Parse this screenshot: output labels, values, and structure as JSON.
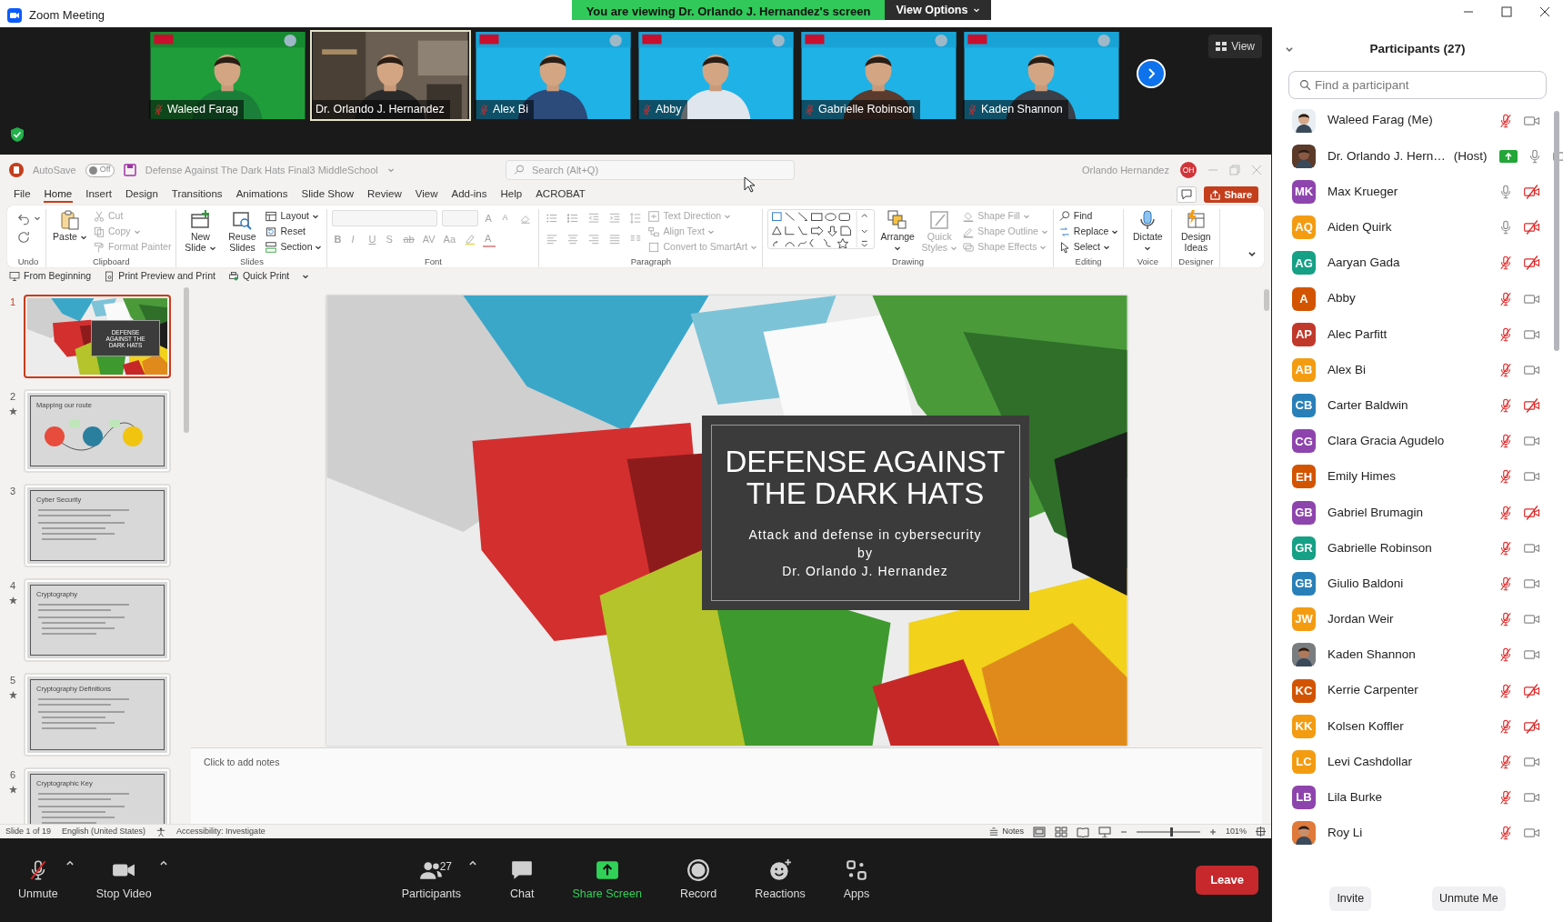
{
  "window": {
    "title": "Zoom Meeting"
  },
  "share_banner": {
    "text": "You are viewing Dr. Orlando J. Hernandez's screen",
    "button": "View Options"
  },
  "video_strip": {
    "view_button": "View",
    "tiles": [
      {
        "name": "Waleed Farag",
        "muted": true,
        "speaking": false,
        "kind": "green"
      },
      {
        "name": "Dr. Orlando J. Hernandez",
        "muted": false,
        "speaking": true,
        "kind": "office"
      },
      {
        "name": "Alex Bi",
        "muted": true,
        "speaking": false,
        "kind": "blue"
      },
      {
        "name": "Abby",
        "muted": true,
        "speaking": false,
        "kind": "blue"
      },
      {
        "name": "Gabrielle Robinson",
        "muted": true,
        "speaking": false,
        "kind": "blue"
      },
      {
        "name": "Kaden Shannon",
        "muted": true,
        "speaking": false,
        "kind": "blue"
      }
    ]
  },
  "powerpoint": {
    "autosave": {
      "label": "AutoSave",
      "toggle": "Off",
      "on": false
    },
    "file_title": "Defense Against The Dark Hats Final3 MiddleSchool",
    "search": {
      "placeholder": "Search (Alt+Q)"
    },
    "user": {
      "name": "Orlando Hernandez",
      "initials": "OH"
    },
    "share_button": "Share",
    "tabs": [
      {
        "label": "File",
        "selected": false
      },
      {
        "label": "Home",
        "selected": true
      },
      {
        "label": "Insert",
        "selected": false
      },
      {
        "label": "Design",
        "selected": false
      },
      {
        "label": "Transitions",
        "selected": false
      },
      {
        "label": "Animations",
        "selected": false
      },
      {
        "label": "Slide Show",
        "selected": false
      },
      {
        "label": "Review",
        "selected": false
      },
      {
        "label": "View",
        "selected": false
      },
      {
        "label": "Add-ins",
        "selected": false
      },
      {
        "label": "Help",
        "selected": false
      },
      {
        "label": "ACROBAT",
        "selected": false
      }
    ],
    "ribbon": [
      {
        "label": "Undo",
        "items": [
          {
            "kind": "icon",
            "disabled": false,
            "dropdown": true
          },
          {
            "kind": "icon",
            "disabled": false,
            "dropdown": false
          }
        ]
      },
      {
        "label": "Clipboard",
        "items": [
          {
            "kind": "large",
            "label": "Paste",
            "disabled": false,
            "dropdown": true
          },
          {
            "kind": "small",
            "label": "Cut",
            "disabled": true,
            "dropdown": false
          },
          {
            "kind": "small",
            "label": "Copy",
            "disabled": true,
            "dropdown": true
          },
          {
            "kind": "small",
            "label": "Format Painter",
            "disabled": true,
            "dropdown": false
          }
        ]
      },
      {
        "label": "Slides",
        "items": [
          {
            "kind": "large",
            "label": "New Slide",
            "disabled": false,
            "dropdown": true
          },
          {
            "kind": "large",
            "label": "Reuse Slides",
            "disabled": false,
            "dropdown": false
          },
          {
            "kind": "small",
            "label": "Layout",
            "disabled": false,
            "dropdown": true
          },
          {
            "kind": "small",
            "label": "Reset",
            "disabled": false,
            "dropdown": false
          },
          {
            "kind": "small",
            "label": "Section",
            "disabled": false,
            "dropdown": true
          }
        ]
      },
      {
        "label": "Font",
        "items": [
          {
            "kind": "toolrow",
            "tools": [
              {
                "kind": "field",
                "disabled": true
              },
              {
                "kind": "field",
                "disabled": true
              },
              {
                "kind": "text",
                "label": "A",
                "disabled": true
              },
              {
                "kind": "text",
                "label": "A",
                "disabled": true
              },
              {
                "kind": "icon",
                "disabled": true
              }
            ]
          },
          {
            "kind": "toolrow",
            "tools": [
              {
                "kind": "text",
                "label": "B",
                "disabled": true
              },
              {
                "kind": "text",
                "label": "I",
                "disabled": true
              },
              {
                "kind": "text",
                "label": "U",
                "disabled": true
              },
              {
                "kind": "text",
                "label": "S",
                "disabled": true
              },
              {
                "kind": "text",
                "label": "ab",
                "disabled": true
              },
              {
                "kind": "text",
                "label": "AV",
                "disabled": true
              },
              {
                "kind": "text",
                "label": "Aa",
                "disabled": true
              },
              {
                "kind": "icon",
                "disabled": true
              },
              {
                "kind": "text",
                "label": "A",
                "disabled": true
              }
            ]
          }
        ]
      },
      {
        "label": "Paragraph",
        "items": [
          {
            "kind": "toolrow",
            "tools": [
              {
                "kind": "icon",
                "disabled": true
              },
              {
                "kind": "icon",
                "disabled": true
              },
              {
                "kind": "icon",
                "disabled": true
              },
              {
                "kind": "icon",
                "disabled": true
              },
              {
                "kind": "icon",
                "disabled": true
              }
            ]
          },
          {
            "kind": "toolrow",
            "tools": [
              {
                "kind": "icon",
                "disabled": true
              },
              {
                "kind": "icon",
                "disabled": true
              },
              {
                "kind": "icon",
                "disabled": true
              },
              {
                "kind": "icon",
                "disabled": true
              },
              {
                "kind": "icon",
                "disabled": true
              }
            ]
          },
          {
            "kind": "small",
            "label": "Text Direction",
            "disabled": true,
            "dropdown": true
          },
          {
            "kind": "small",
            "label": "Align Text",
            "disabled": true,
            "dropdown": true
          },
          {
            "kind": "small",
            "label": "Convert to SmartArt",
            "disabled": true,
            "dropdown": true
          }
        ]
      },
      {
        "label": "Drawing",
        "items": [
          {
            "kind": "gallery"
          },
          {
            "kind": "large",
            "label": "Arrange",
            "disabled": false,
            "dropdown": true
          },
          {
            "kind": "large",
            "label": "Quick Styles",
            "disabled": true,
            "dropdown": true
          },
          {
            "kind": "small",
            "label": "Shape Fill",
            "disabled": true,
            "dropdown": true
          },
          {
            "kind": "small",
            "label": "Shape Outline",
            "disabled": true,
            "dropdown": true
          },
          {
            "kind": "small",
            "label": "Shape Effects",
            "disabled": true,
            "dropdown": true
          }
        ]
      },
      {
        "label": "Editing",
        "items": [
          {
            "kind": "small",
            "label": "Find",
            "disabled": false,
            "dropdown": false
          },
          {
            "kind": "small",
            "label": "Replace",
            "disabled": false,
            "dropdown": true
          },
          {
            "kind": "small",
            "label": "Select",
            "disabled": false,
            "dropdown": true
          }
        ]
      },
      {
        "label": "Voice",
        "items": [
          {
            "kind": "large",
            "label": "Dictate",
            "disabled": false,
            "dropdown": true
          }
        ]
      },
      {
        "label": "Designer",
        "items": [
          {
            "kind": "large",
            "label": "Design Ideas",
            "disabled": false,
            "dropdown": false
          }
        ]
      }
    ],
    "quick_access": [
      "From Beginning",
      "Print Preview and Print",
      "Quick Print"
    ],
    "slides": [
      {
        "number": "1",
        "title": "DEFENSE AGAINST THE DARK HATS",
        "kind": "cover",
        "animated": false,
        "selected": true
      },
      {
        "number": "2",
        "title": "Mapping our route",
        "kind": "diagram",
        "animated": true,
        "selected": false
      },
      {
        "number": "3",
        "title": "Cyber Security",
        "kind": "bullets",
        "animated": false,
        "selected": false
      },
      {
        "number": "4",
        "title": "Cryptography",
        "kind": "bullets",
        "animated": true,
        "selected": false
      },
      {
        "number": "5",
        "title": "Cryptography Definitions",
        "kind": "bullets",
        "animated": true,
        "selected": false
      },
      {
        "number": "6",
        "title": "Cryptographic Key",
        "kind": "bullets",
        "animated": true,
        "selected": false
      }
    ],
    "main_slide": {
      "title": "DEFENSE AGAINST THE DARK HATS",
      "lines": [
        "Attack and defense in cybersecurity",
        "by",
        "Dr. Orlando J. Hernandez"
      ]
    },
    "notes": {
      "placeholder": "Click to add notes"
    },
    "status": {
      "slide": "Slide 1 of 19",
      "language": "English (United States)",
      "accessibility": "Accessibility: Investigate",
      "notes": "Notes",
      "zoom": {
        "level": 0.55,
        "label": "101%"
      }
    }
  },
  "toolbar": {
    "items": [
      {
        "label": "Unmute",
        "caret": true,
        "accent": false
      },
      {
        "label": "Stop Video",
        "caret": true,
        "accent": false
      },
      {
        "label": "Participants",
        "count": "27",
        "caret": true,
        "accent": false
      },
      {
        "label": "Chat",
        "caret": false,
        "accent": false
      },
      {
        "label": "Share Screen",
        "caret": false,
        "accent": true
      },
      {
        "label": "Record",
        "caret": false,
        "accent": false
      },
      {
        "label": "Reactions",
        "caret": false,
        "accent": false
      },
      {
        "label": "Apps",
        "caret": false,
        "accent": false
      }
    ],
    "leave": "Leave"
  },
  "participants": {
    "title": "Participants (27)",
    "search": {
      "placeholder": "Find a participant"
    },
    "list": [
      {
        "name": "Waleed Farag (Me)",
        "sharing": false,
        "muted": true,
        "video_on": true
      },
      {
        "name": "Dr. Orlando J. Hern…",
        "role": "(Host)",
        "sharing": true,
        "muted": false,
        "video_on": true
      },
      {
        "name": "Max Krueger",
        "initials": "MK",
        "color": "#8e44ad",
        "sharing": false,
        "muted": false,
        "video_on": false
      },
      {
        "name": "Aiden Quirk",
        "initials": "AQ",
        "color": "#f39c12",
        "sharing": false,
        "muted": false,
        "video_on": false
      },
      {
        "name": "Aaryan Gada",
        "initials": "AG",
        "color": "#16a085",
        "sharing": false,
        "muted": true,
        "video_on": false
      },
      {
        "name": "Abby",
        "initials": "A",
        "color": "#d35400",
        "sharing": false,
        "muted": true,
        "video_on": true
      },
      {
        "name": "Alec Parfitt",
        "initials": "AP",
        "color": "#c0392b",
        "sharing": false,
        "muted": true,
        "video_on": true
      },
      {
        "name": "Alex Bi",
        "initials": "AB",
        "color": "#f39c12",
        "sharing": false,
        "muted": true,
        "video_on": true
      },
      {
        "name": "Carter Baldwin",
        "initials": "CB",
        "color": "#2980b9",
        "sharing": false,
        "muted": true,
        "video_on": false
      },
      {
        "name": "Clara Gracia Agudelo",
        "initials": "CG",
        "color": "#8e44ad",
        "sharing": false,
        "muted": true,
        "video_on": true
      },
      {
        "name": "Emily Himes",
        "initials": "EH",
        "color": "#d35400",
        "sharing": false,
        "muted": true,
        "video_on": true
      },
      {
        "name": "Gabriel Brumagin",
        "initials": "GB",
        "color": "#8e44ad",
        "sharing": false,
        "muted": true,
        "video_on": false
      },
      {
        "name": "Gabrielle Robinson",
        "initials": "GR",
        "color": "#16a085",
        "sharing": false,
        "muted": true,
        "video_on": true
      },
      {
        "name": "Giulio Baldoni",
        "initials": "GB",
        "color": "#2980b9",
        "sharing": false,
        "muted": true,
        "video_on": true
      },
      {
        "name": "Jordan Weir",
        "initials": "JW",
        "color": "#f39c12",
        "sharing": false,
        "muted": true,
        "video_on": true
      },
      {
        "name": "Kaden Shannon",
        "sharing": false,
        "muted": true,
        "video_on": true
      },
      {
        "name": "Kerrie Carpenter",
        "initials": "KC",
        "color": "#d35400",
        "sharing": false,
        "muted": true,
        "video_on": false
      },
      {
        "name": "Kolsen Koffler",
        "initials": "KK",
        "color": "#f39c12",
        "sharing": false,
        "muted": true,
        "video_on": false
      },
      {
        "name": "Levi Cashdollar",
        "initials": "LC",
        "color": "#f39c12",
        "sharing": false,
        "muted": true,
        "video_on": true
      },
      {
        "name": "Lila Burke",
        "initials": "LB",
        "color": "#8e44ad",
        "sharing": false,
        "muted": true,
        "video_on": true
      },
      {
        "name": "Roy Li",
        "sharing": false,
        "muted": true,
        "video_on": true
      }
    ],
    "buttons": [
      "Invite",
      "Unmute Me"
    ]
  }
}
